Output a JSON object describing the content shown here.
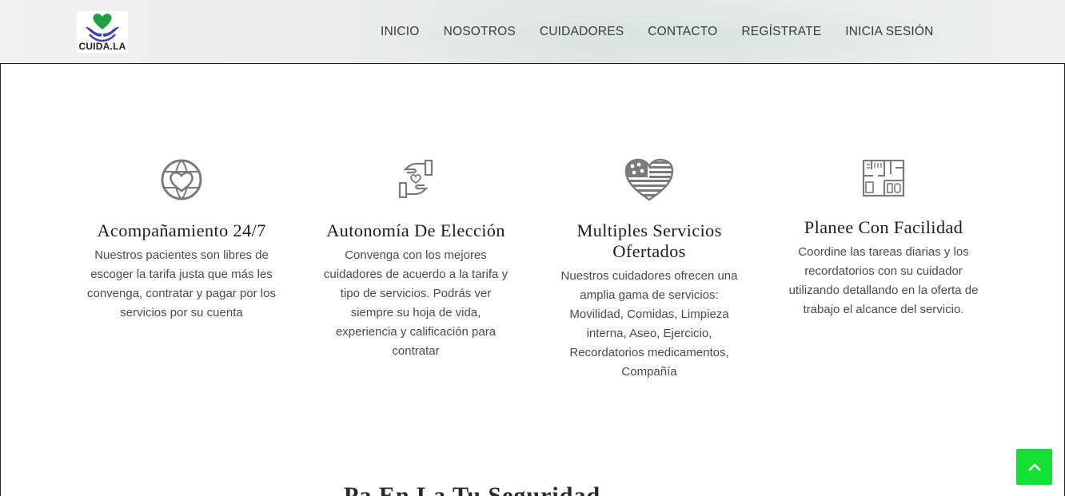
{
  "brand": {
    "name": "CUIDA.LA",
    "logo_icon": "heart-hands-icon",
    "heart_color": "#1e9f43",
    "hands_color": "#3c44a8"
  },
  "nav": {
    "items": [
      "INICIO",
      "NOSOTROS",
      "CUIDADORES",
      "CONTACTO",
      "REGÍSTRATE",
      "INICIA SESIÓN"
    ]
  },
  "features": [
    {
      "icon": "globe-heart-icon",
      "title": "Acompañamiento 24/7",
      "description": "Nuestros pacientes son libres de escoger la tarifa justa que más les convenga, contratar y pagar por los servicios por su cuenta"
    },
    {
      "icon": "hands-heart-icon",
      "title": "Autonomía De Elección",
      "description": "Convenga con los mejores cuidadores de acuerdo a la tarifa y tipo de servicios. Podrás ver siempre su hoja de vida, experiencia y calificación para contratar"
    },
    {
      "icon": "striped-heart-icon",
      "title": "Multiples Servicios Ofertados",
      "description": "Nuestros cuidadores ofrecen una amplia gama de servicios: Movilidad, Comidas, Limpieza interna, Aseo, Ejercicio, Recordatorios medicamentos, Compañía"
    },
    {
      "icon": "floor-plan-icon",
      "title": "Planee Con Facilidad",
      "description": "Coordine las tareas diarias y los recordatorios con su cuidador utilizando detallando en la oferta de trabajo el alcance del servicio."
    }
  ],
  "section_heading": "Pa  En La Tu Seguridad",
  "back_to_top": {
    "icon": "chevron-up-icon",
    "color": "#13e034"
  }
}
